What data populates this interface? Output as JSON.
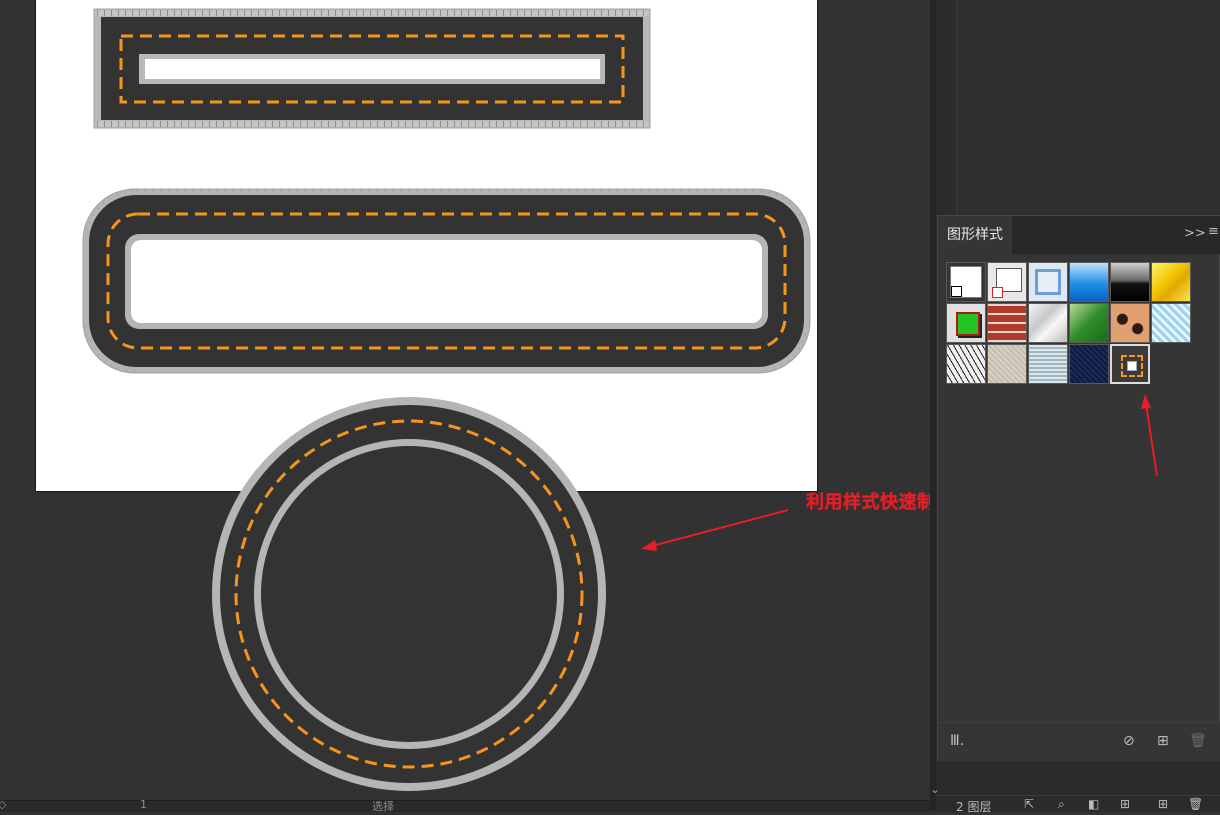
{
  "annotation": {
    "text": "利用样式快速制作的跑道",
    "color": "#e51e28"
  },
  "panel": {
    "title": "图形样式",
    "expand_glyph": ">>",
    "menu_glyph": "≡",
    "swatches": [
      {
        "name": "default-graphic-style",
        "kind": "default"
      },
      {
        "name": "no-fill-style",
        "kind": "none"
      },
      {
        "name": "blue-outline-style",
        "kind": "blue-outline"
      },
      {
        "name": "blue-gradient-style",
        "kind": "blue-gradient"
      },
      {
        "name": "gray-black-gradient-style",
        "kind": "black-gradient"
      },
      {
        "name": "yellow-leaf-style",
        "kind": "yellow"
      },
      {
        "name": "green-square-style",
        "kind": "green"
      },
      {
        "name": "brick-style",
        "kind": "brick"
      },
      {
        "name": "white-fur-style",
        "kind": "fur"
      },
      {
        "name": "green-grass-style",
        "kind": "grass"
      },
      {
        "name": "leopard-style",
        "kind": "leopard"
      },
      {
        "name": "blue-ice-style",
        "kind": "ice"
      },
      {
        "name": "cracked-stone-style",
        "kind": "cracked"
      },
      {
        "name": "sand-style",
        "kind": "sand"
      },
      {
        "name": "water-style",
        "kind": "water"
      },
      {
        "name": "dark-blue-texture-style",
        "kind": "darkblue"
      },
      {
        "name": "running-track-style",
        "kind": "track"
      }
    ],
    "footer_icons": [
      "library-icon",
      "break-link-icon",
      "new-style-icon",
      "delete-style-icon"
    ]
  },
  "layers_bar": {
    "label": "2 图层"
  },
  "bottom_bar": {
    "page_value": "1",
    "left_glyph": "◇",
    "select_label": "选择"
  },
  "colors": {
    "track_asphalt": "#333333",
    "track_edge": "#b3b3b3",
    "lane_dash": "#f7941d",
    "arrow": "#e51e28"
  }
}
